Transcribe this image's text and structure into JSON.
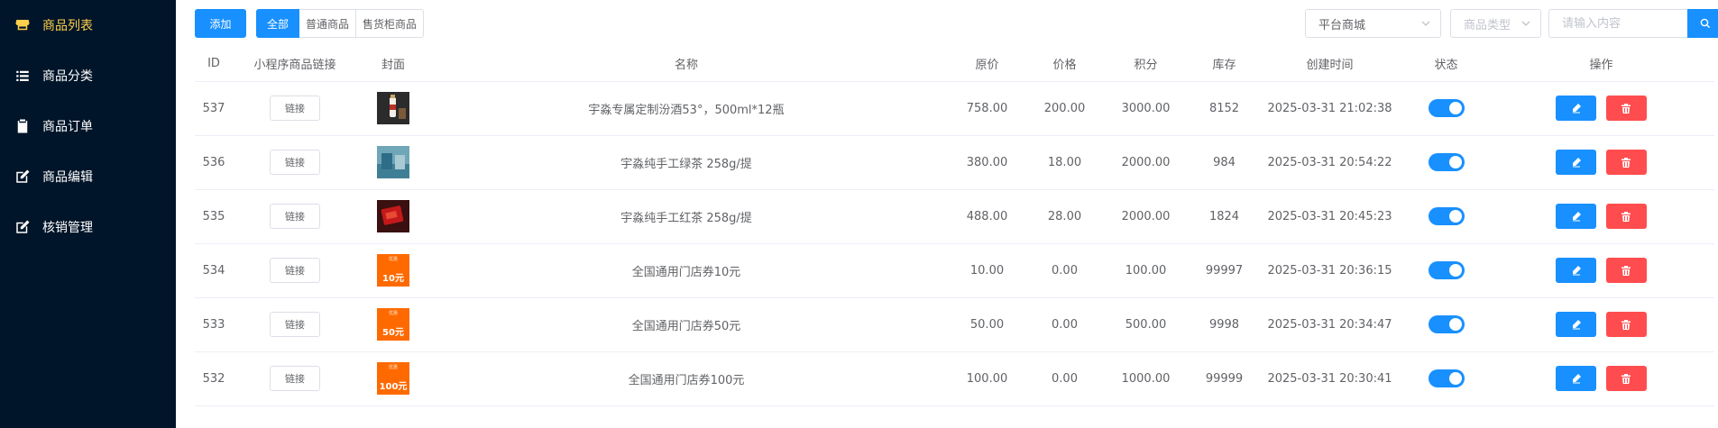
{
  "sidebar": {
    "items": [
      {
        "label": "商品列表",
        "icon": "store-icon",
        "active": true
      },
      {
        "label": "商品分类",
        "icon": "list-icon",
        "active": false
      },
      {
        "label": "商品订单",
        "icon": "clipboard-icon",
        "active": false
      },
      {
        "label": "商品编辑",
        "icon": "edit-icon",
        "active": false
      },
      {
        "label": "核销管理",
        "icon": "edit-icon",
        "active": false
      }
    ]
  },
  "toolbar": {
    "add_label": "添加",
    "filters": [
      "全部",
      "普通商品",
      "售货柜商品"
    ],
    "active_filter": "全部",
    "mall_select": "平台商城",
    "type_select_placeholder": "商品类型",
    "search_placeholder": "请输入内容"
  },
  "table": {
    "headers": [
      "ID",
      "小程序商品链接",
      "封面",
      "名称",
      "原价",
      "价格",
      "积分",
      "库存",
      "创建时间",
      "状态",
      "操作"
    ],
    "link_label": "链接",
    "rows": [
      {
        "id": "537",
        "cover": "liquor-photo",
        "name": "宇淼专属定制汾酒53°，500ml*12瓶",
        "orig": "758.00",
        "price": "200.00",
        "points": "3000.00",
        "stock": "8152",
        "created": "2025-03-31 21:02:38",
        "status_on": true
      },
      {
        "id": "536",
        "cover": "green-tea-photo",
        "name": "宇淼纯手工绿茶 258g/提",
        "orig": "380.00",
        "price": "18.00",
        "points": "2000.00",
        "stock": "984",
        "created": "2025-03-31 20:54:22",
        "status_on": true
      },
      {
        "id": "535",
        "cover": "red-tea-photo",
        "name": "宇淼纯手工红茶 258g/提",
        "orig": "488.00",
        "price": "28.00",
        "points": "2000.00",
        "stock": "1824",
        "created": "2025-03-31 20:45:23",
        "status_on": true
      },
      {
        "id": "534",
        "cover": "coupon",
        "coupon_amount": "10元",
        "name": "全国通用门店券10元",
        "orig": "10.00",
        "price": "0.00",
        "points": "100.00",
        "stock": "99997",
        "created": "2025-03-31 20:36:15",
        "status_on": true
      },
      {
        "id": "533",
        "cover": "coupon",
        "coupon_amount": "50元",
        "name": "全国通用门店券50元",
        "orig": "50.00",
        "price": "0.00",
        "points": "500.00",
        "stock": "9998",
        "created": "2025-03-31 20:34:47",
        "status_on": true
      },
      {
        "id": "532",
        "cover": "coupon",
        "coupon_amount": "100元",
        "name": "全国通用门店券100元",
        "orig": "100.00",
        "price": "0.00",
        "points": "1000.00",
        "stock": "99999",
        "created": "2025-03-31 20:30:41",
        "status_on": true
      }
    ]
  },
  "colors": {
    "sidebar_bg": "#001529",
    "accent": "#1890ff",
    "active_menu": "#ffd04b",
    "danger": "#ff4d4f",
    "coupon": "#ff6a00"
  }
}
